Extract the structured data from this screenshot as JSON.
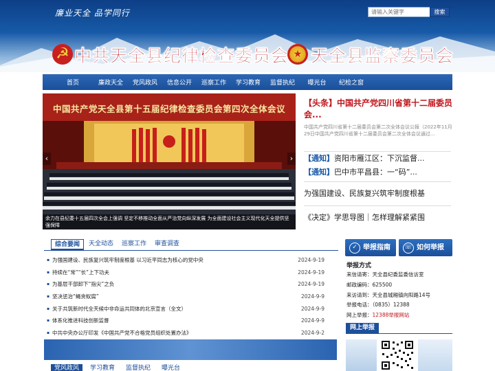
{
  "header": {
    "slogan": "廉业天全  品学同行",
    "search_placeholder": "请输入关键字",
    "search_button": "搜索",
    "title_left": "中共天全县纪律检查委员会",
    "title_right": "天全县监察委员会"
  },
  "nav": {
    "items": [
      "首页",
      "廉政天全",
      "党风政风",
      "信息公开",
      "巡察工作",
      "学习教育",
      "监督执纪",
      "曝光台",
      "纪检之窗"
    ]
  },
  "feature": {
    "meeting_title": "中国共产党天全县第十五届纪律检查委员会第四次全体会议",
    "caption": "余力在县纪委十五届四次全会上强调 坚定不移推动全面从严治党向纵深发展 为全面建设社会主义现代化天全提供坚强保障",
    "prev": "‹",
    "next": "›"
  },
  "headline": {
    "title": "【头条】中国共产党四川省第十二届委员会...",
    "summary": "中国共产党四川省第十二届委员会第二次全体会议公报（2022年11月29日中国共产党四川省第十二届委员会第二次全体会议通过..."
  },
  "notices": [
    {
      "tag": "【通知】",
      "text": "资阳市雁江区：下沉监督..."
    },
    {
      "tag": "【通知】",
      "text": "巴中市平昌县：一“码”..."
    }
  ],
  "links": [
    "为强国建设、民族复兴筑牢制度根基",
    "《决定》学思导图｜怎样理解紧紧围"
  ],
  "news": {
    "tabs": [
      "综合要闻",
      "天全动态",
      "巡察工作",
      "审查调查"
    ],
    "items": [
      {
        "title": "为强国建设、民族复兴筑牢制度根基 以习近平同志为核心的党中央",
        "date": "2024-9-19"
      },
      {
        "title": "持续在“常”“长”上下功夫",
        "date": "2024-9-19"
      },
      {
        "title": "为基层干部卸下“指尖”之负",
        "date": "2024-9-19"
      },
      {
        "title": "坚决惩治“蝇贪蚁腐”",
        "date": "2024-9-9"
      },
      {
        "title": "关于共筑新时代全天候中非命运共同体的北京宣言（全文）",
        "date": "2024-9-9"
      },
      {
        "title": "体系化推进科技创新监督",
        "date": "2024-9-9"
      },
      {
        "title": "中共中央办公厅印发《中国共产党不合格党员组织处置办法》",
        "date": "2024-9-2"
      }
    ]
  },
  "bottom_tabs": [
    "党风政风",
    "学习教育",
    "监督执纪",
    "曝光台"
  ],
  "right": {
    "btn_guide": "举报指南",
    "btn_how": "如何举报",
    "report_title": "举报方式",
    "report_lines": [
      "来信请寄：天全县纪委监委信访室",
      "邮政编码：625500",
      "来访请到：天全县城厢镇向阳路14号",
      "举报电话：（0835）12388"
    ],
    "online_prefix": "网上举报：",
    "online_value": "12388举报网站",
    "online_tab": "网上举报"
  }
}
